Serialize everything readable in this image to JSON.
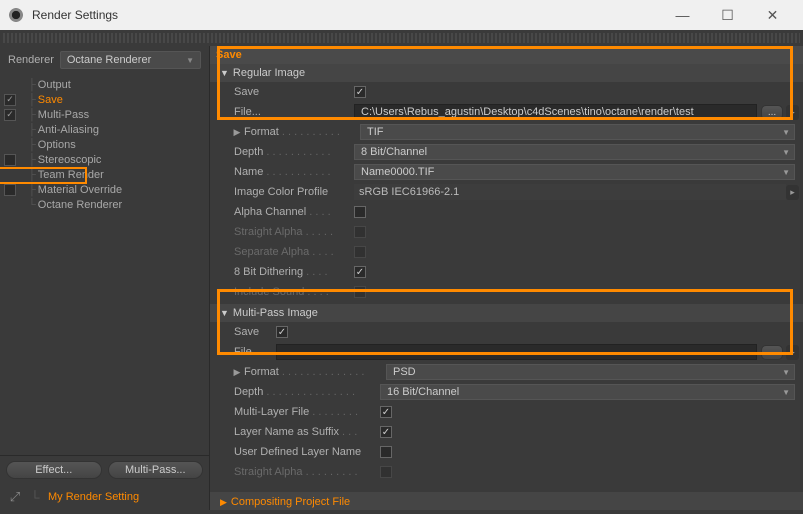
{
  "window": {
    "title": "Render Settings"
  },
  "sidebar": {
    "renderer_label": "Renderer",
    "renderer_value": "Octane Renderer",
    "items": [
      {
        "label": "Output",
        "checked": null
      },
      {
        "label": "Save",
        "checked": true
      },
      {
        "label": "Multi-Pass",
        "checked": true
      },
      {
        "label": "Anti-Aliasing",
        "checked": null
      },
      {
        "label": "Options",
        "checked": null
      },
      {
        "label": "Stereoscopic",
        "checked": false
      },
      {
        "label": "Team Render",
        "checked": null
      },
      {
        "label": "Material Override",
        "checked": false
      },
      {
        "label": "Octane Renderer",
        "checked": null
      }
    ],
    "effect_btn": "Effect...",
    "multipass_btn": "Multi-Pass...",
    "preset": "My Render Setting"
  },
  "tab": {
    "title": "Save"
  },
  "regular": {
    "title": "Regular Image",
    "save_label": "Save",
    "save_checked": true,
    "file_label": "File...",
    "file_value": "C:\\Users\\Rebus_agustin\\Desktop\\c4dScenes\\tino\\octane\\render\\test",
    "browse": "...",
    "format_label": "Format",
    "format_value": "TIF",
    "depth_label": "Depth",
    "depth_value": "8 Bit/Channel",
    "name_label": "Name",
    "name_value": "Name0000.TIF",
    "profile_label": "Image Color Profile",
    "profile_value": "sRGB IEC61966-2.1",
    "alpha_label": "Alpha Channel",
    "straight_label": "Straight Alpha",
    "separate_label": "Separate Alpha",
    "dither_label": "8 Bit Dithering",
    "sound_label": "Include Sound"
  },
  "multipass": {
    "title": "Multi-Pass Image",
    "save_label": "Save",
    "file_label": "File",
    "file_value": "",
    "browse": "...",
    "format_label": "Format",
    "format_value": "PSD",
    "depth_label": "Depth",
    "depth_value": "16 Bit/Channel",
    "multilayer_label": "Multi-Layer File",
    "layername_label": "Layer Name as Suffix",
    "userdef_label": "User Defined Layer Name",
    "straight_label": "Straight Alpha"
  },
  "compositing": {
    "title": "Compositing Project File"
  }
}
